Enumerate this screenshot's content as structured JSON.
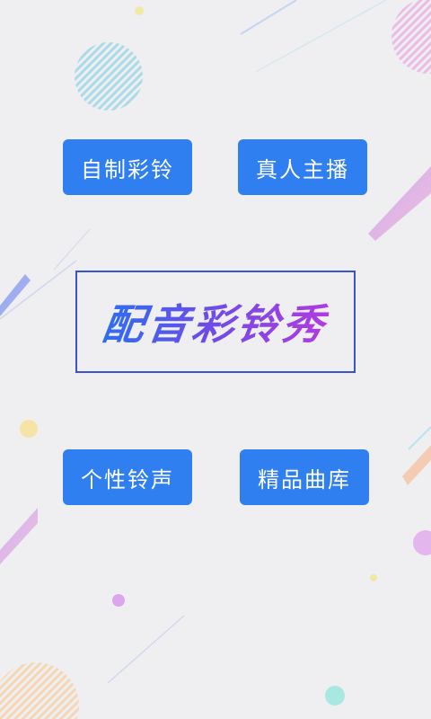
{
  "title": "配音彩铃秀",
  "buttons": {
    "custom_ringtone": "自制彩铃",
    "real_anchor": "真人主播",
    "personal_ringtone": "个性铃声",
    "premium_library": "精品曲库"
  },
  "colors": {
    "background": "#efeff1",
    "button": "#2f7ff0",
    "title_border": "#3a55c8"
  }
}
